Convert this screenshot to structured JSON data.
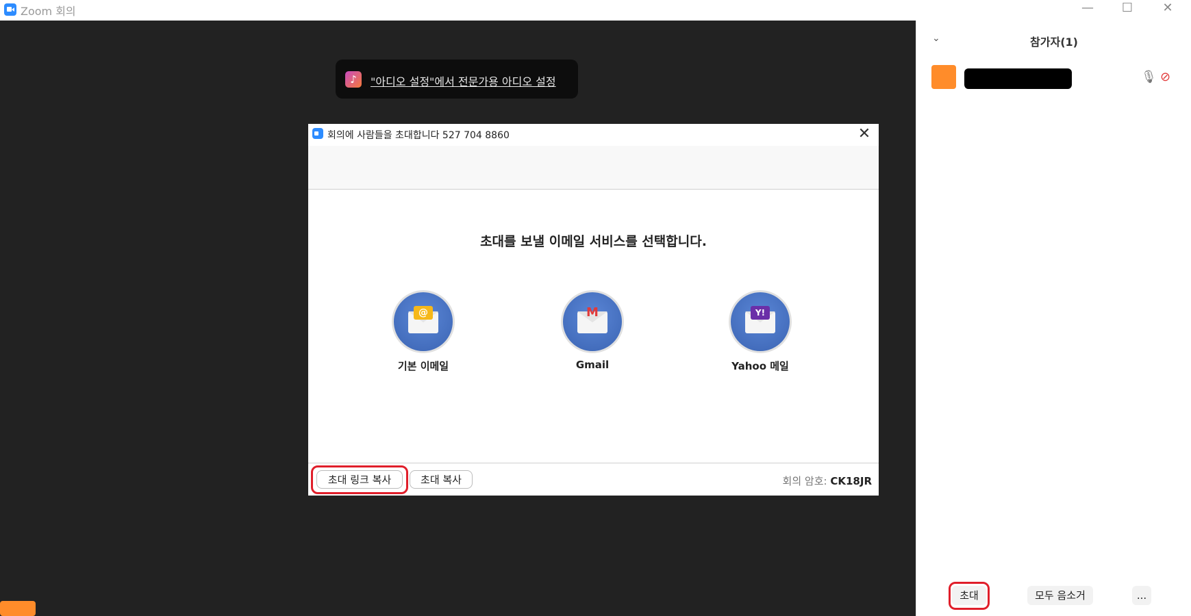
{
  "window": {
    "title": "Zoom 회의",
    "minimize": "—",
    "maximize": "☐",
    "close": "✕"
  },
  "toast": {
    "icon": "♪",
    "text": "\"아디오 설정\"에서 전문가용 아디오 설정"
  },
  "dialog": {
    "title": "회의에 사람들을 초대합니다 527 704 8860",
    "close": "✕",
    "heading": "초대를 보낼 이메일 서비스를 선택합니다.",
    "services": [
      {
        "label": "기본 이메일",
        "icon": "default-email-icon",
        "glyph": "@"
      },
      {
        "label": "Gmail",
        "icon": "gmail-icon",
        "glyph": "M"
      },
      {
        "label": "Yahoo 메일",
        "icon": "yahoo-mail-icon",
        "glyph": "Y!"
      }
    ],
    "copy_link_button": "초대 링크 복사",
    "copy_invite_button": "초대 복사",
    "password_label": "회의 암호:",
    "password_value": "CK18JR"
  },
  "panel": {
    "chevron": "⌄",
    "title": "참가자(1)",
    "mic_icon": "🎙",
    "video_icon": "⊘",
    "invite_button": "초대",
    "mute_all_button": "모두 음소거",
    "more_button": "..."
  },
  "colors": {
    "accent": "#2d8cff",
    "highlight": "#e01e2a",
    "avatar": "#ff8c2a",
    "stage": "#222222"
  }
}
